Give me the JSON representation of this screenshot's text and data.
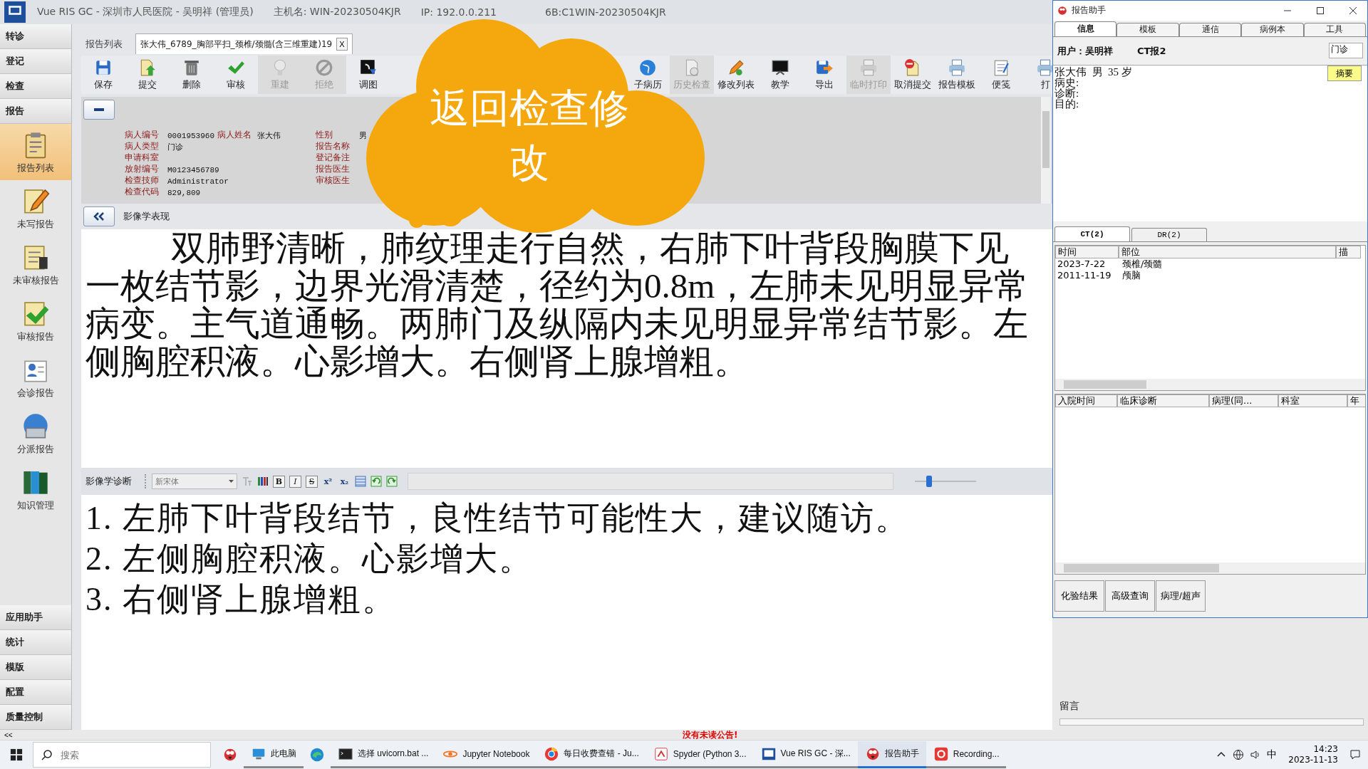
{
  "window": {
    "title": "Vue RIS GC - 深圳市人民医院 - 吴明祥 (管理员)",
    "host": "主机名: WIN-20230504KJR",
    "ip": "IP: 192.0.0.211",
    "machine": "6B:C1WIN-20230504KJR"
  },
  "sidebar": {
    "top_items": [
      {
        "label": "转诊"
      },
      {
        "label": "登记"
      },
      {
        "label": "检查"
      },
      {
        "label": "报告"
      }
    ],
    "items": [
      {
        "label": "报告列表",
        "selected": true
      },
      {
        "label": "未写报告",
        "selected": false
      },
      {
        "label": "未审核报告",
        "selected": false
      },
      {
        "label": "审核报告",
        "selected": false
      },
      {
        "label": "会诊报告",
        "selected": false
      },
      {
        "label": "分派报告",
        "selected": false
      },
      {
        "label": "知识管理",
        "selected": false
      }
    ],
    "bottom_items": [
      {
        "label": "应用助手"
      },
      {
        "label": "统计"
      },
      {
        "label": "模版"
      },
      {
        "label": "配置"
      },
      {
        "label": "质量控制"
      }
    ]
  },
  "tabs": [
    {
      "label": "报告列表",
      "selected": false
    },
    {
      "label": "张大伟_6789_胸部平扫_颈椎/颈髓(含三维重建)19",
      "selected": true,
      "close": "X"
    }
  ],
  "toolbar": [
    {
      "label": "保存",
      "disabled": false
    },
    {
      "label": "提交",
      "disabled": false
    },
    {
      "label": "删除",
      "disabled": false
    },
    {
      "label": "审核",
      "disabled": false
    },
    {
      "label": "重建",
      "disabled": true
    },
    {
      "label": "拒绝",
      "disabled": true
    },
    {
      "label": "调图",
      "disabled": false
    },
    {
      "label": "子病历",
      "disabled": false
    },
    {
      "label": "历史检查",
      "disabled": true
    },
    {
      "label": "修改列表",
      "disabled": false
    },
    {
      "label": "教学",
      "disabled": false
    },
    {
      "label": "导出",
      "disabled": false
    },
    {
      "label": "临时打印",
      "disabled": true
    },
    {
      "label": "取消提交",
      "disabled": false
    },
    {
      "label": "报告模板",
      "disabled": false
    },
    {
      "label": "便笺",
      "disabled": false
    },
    {
      "label": "打",
      "disabled": false
    }
  ],
  "patient_info": {
    "groups": [
      [
        {
          "label": "病人编号",
          "value": "0001953960"
        },
        {
          "label": "病人类型",
          "value": "门诊"
        },
        {
          "label": "申请科室"
        },
        {
          "label": "放射编号",
          "value": "M0123456789"
        },
        {
          "label": "检查技师",
          "value": "Administrator"
        },
        {
          "label": "检查代码",
          "value": "829,809"
        }
      ],
      [
        {
          "label": "病人姓名",
          "value": "张大伟"
        }
      ],
      [
        {
          "label": "性别",
          "value": "男"
        },
        {
          "label": "报告名称"
        },
        {
          "label": "登记备注"
        },
        {
          "label": "报告医生"
        },
        {
          "label": "审核医生"
        }
      ]
    ]
  },
  "findings": {
    "title": "影像学表现",
    "text": "双肺野清晰，肺纹理走行自然，右肺下叶背段胸膜下见一枚结节影，边界光滑清楚，径约为0.8m，左肺未见明显异常病变。主气道通畅。两肺门及纵隔内未见明显异常结节影。左侧胸腔积液。心影增大。右侧肾上腺增粗。"
  },
  "diagnosis": {
    "title": "影像学诊断",
    "font": "新宋体",
    "format_buttons": [
      "B",
      "I",
      "S",
      "x²",
      "x₂"
    ],
    "zoom": {
      "level": 0.23
    },
    "lines": [
      "1. 左肺下叶背段结节，良性结节可能性大，建议随访。",
      "2. 左侧胸腔积液。心影增大。",
      "3. 右侧肾上腺增粗。"
    ]
  },
  "callout": {
    "text": "返回检查修改"
  },
  "assistant": {
    "title": "报告助手",
    "tabs": [
      {
        "label": "信息",
        "selected": true
      },
      {
        "label": "模板",
        "selected": false
      },
      {
        "label": "通信",
        "selected": false
      },
      {
        "label": "病例本",
        "selected": false
      },
      {
        "label": "工具",
        "selected": false
      }
    ],
    "user": "用户：吴明祥",
    "report": "CT报2",
    "visit_type": "门诊",
    "summary_button": "摘要",
    "notes": [
      "张大伟  男  35 岁",
      "病史:",
      "诊断:",
      "目的:"
    ],
    "modality_tabs": [
      {
        "label": "CT(2)",
        "selected": true
      },
      {
        "label": "DR(2)",
        "selected": false
      }
    ],
    "history_table": {
      "columns": [
        "时间",
        "部位",
        "描"
      ],
      "rows": [
        [
          "2023-7-22",
          "颈椎/颈髓"
        ],
        [
          "2011-11-19",
          "颅脑"
        ]
      ]
    },
    "admission_table": {
      "columns": [
        "入院时间",
        "临床诊断",
        "病理(同...",
        "科室",
        "年"
      ]
    },
    "buttons": [
      "化验结果",
      "高级查询",
      "病理/超声"
    ]
  },
  "messages": {
    "title": "留言"
  },
  "status_bar": {
    "collapse": "<<",
    "notice": "没有未读公告!"
  },
  "taskbar": {
    "search": {
      "placeholder": "搜索"
    },
    "apps": [
      {
        "active": false
      },
      {
        "label": "此电脑",
        "active": false
      },
      {
        "active": false
      },
      {
        "label": "选择 uvicorn.bat ...",
        "active": false
      },
      {
        "label": "Jupyter Notebook",
        "active": false
      },
      {
        "label": "每日收费查错 - Ju...",
        "active": false
      },
      {
        "label": "Spyder (Python 3...",
        "active": false
      },
      {
        "label": "Vue RIS GC - 深...",
        "active": false
      },
      {
        "label": "报告助手",
        "active": true
      },
      {
        "label": "Recording...",
        "active": false
      }
    ],
    "tray": {
      "ime": "中",
      "time": "14:23",
      "date": "2023-11-13"
    }
  }
}
